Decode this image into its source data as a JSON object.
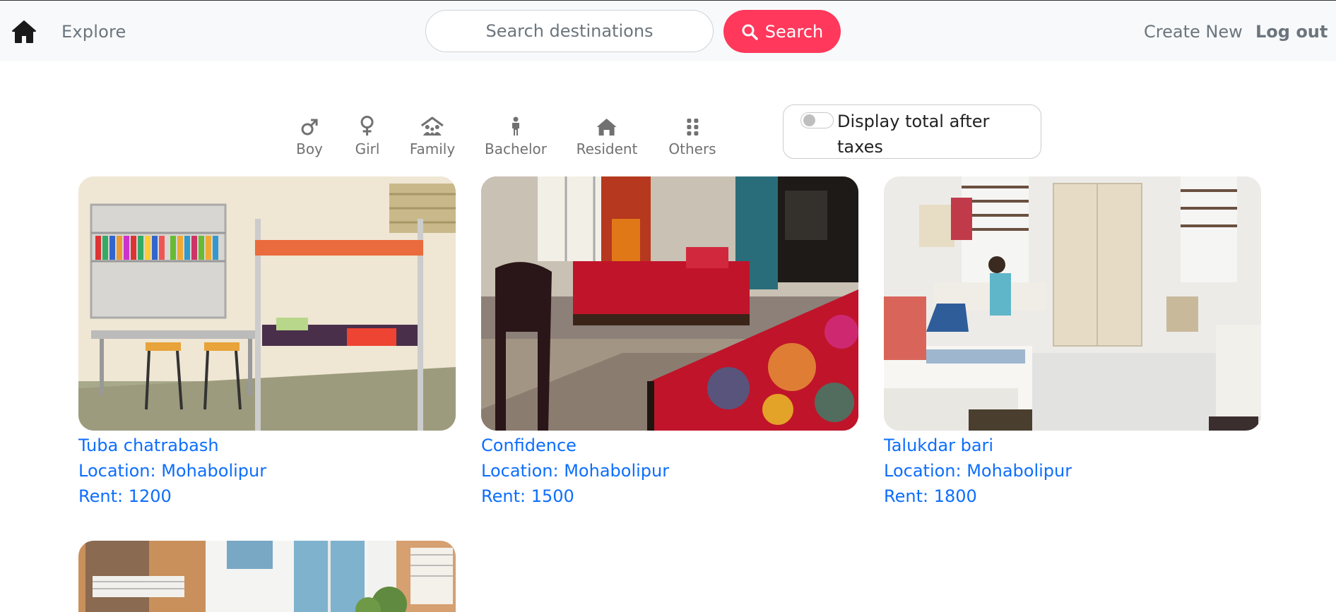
{
  "navbar": {
    "home_icon": "home-icon",
    "explore_label": "Explore",
    "search_placeholder": "Search destinations",
    "search_button_label": "Search",
    "search_icon": "magnifier-icon",
    "create_new_label": "Create New",
    "logout_label": "Log out",
    "accent_color": "#ff385c"
  },
  "filters": [
    {
      "label": "Boy",
      "icon": "male-symbol-icon"
    },
    {
      "label": "Girl",
      "icon": "female-symbol-icon"
    },
    {
      "label": "Family",
      "icon": "family-house-icon"
    },
    {
      "label": "Bachelor",
      "icon": "person-icon"
    },
    {
      "label": "Resident",
      "icon": "house-icon"
    },
    {
      "label": "Others",
      "icon": "grid-dots-icon"
    }
  ],
  "tax_toggle": {
    "label": "Display total after taxes",
    "checked": false
  },
  "listings": [
    {
      "title": "Tuba chatrabash",
      "location": "Location: Mohabolipur",
      "rent": "Rent: 1200",
      "image": "dorm room with bunk beds and bookshelves"
    },
    {
      "title": "Confidence",
      "location": "Location: Mohabolipur",
      "rent": "Rent: 1500",
      "image": "room with red patterned beds"
    },
    {
      "title": "Talukdar bari",
      "location": "Location: Mohabolipur",
      "rent": "Rent: 1800",
      "image": "bright room with students studying"
    },
    {
      "title": "",
      "location": "",
      "rent": "",
      "image": "building exterior with balconies"
    }
  ],
  "link_color": "#0d6efd"
}
